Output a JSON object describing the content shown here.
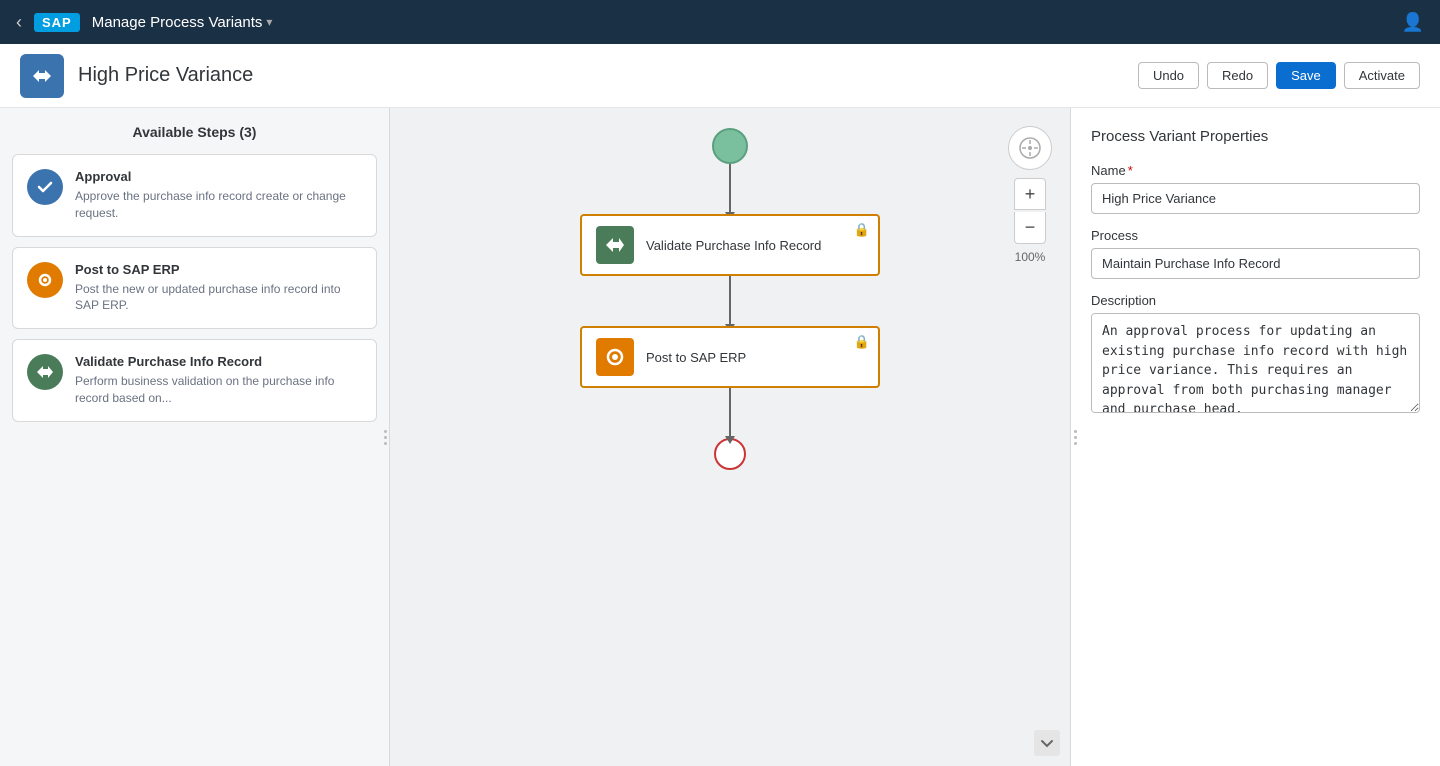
{
  "nav": {
    "title": "Manage Process Variants",
    "back_label": "‹",
    "logo": "SAP",
    "user_icon": "👤"
  },
  "toolbar": {
    "page_title": "High Price Variance",
    "app_icon_label": ">>",
    "undo_label": "Undo",
    "redo_label": "Redo",
    "save_label": "Save",
    "activate_label": "Activate"
  },
  "left_panel": {
    "title": "Available Steps (3)",
    "steps": [
      {
        "id": "approval",
        "name": "Approval",
        "description": "Approve the purchase info record create or change request.",
        "icon_type": "approval"
      },
      {
        "id": "post-sap",
        "name": "Post to SAP ERP",
        "description": "Post the new or updated purchase info record into SAP ERP.",
        "icon_type": "post"
      },
      {
        "id": "validate",
        "name": "Validate Purchase Info Record",
        "description": "Perform business validation on the purchase info record based on...",
        "icon_type": "validate"
      }
    ]
  },
  "canvas": {
    "zoom_level": "100%",
    "flow_nodes": [
      {
        "id": "validate-node",
        "label": "Validate Purchase Info Record",
        "icon_type": "validate",
        "locked": true
      },
      {
        "id": "post-node",
        "label": "Post to SAP ERP",
        "icon_type": "post",
        "locked": true
      }
    ]
  },
  "right_panel": {
    "title": "Process Variant Properties",
    "fields": {
      "name_label": "Name",
      "name_required": true,
      "name_value": "High Price Variance",
      "process_label": "Process",
      "process_value": "Maintain Purchase Info Record",
      "description_label": "Description",
      "description_value": "An approval process for updating an existing purchase info record with high price variance. This requires an approval from both purchasing manager and purchase head."
    }
  }
}
